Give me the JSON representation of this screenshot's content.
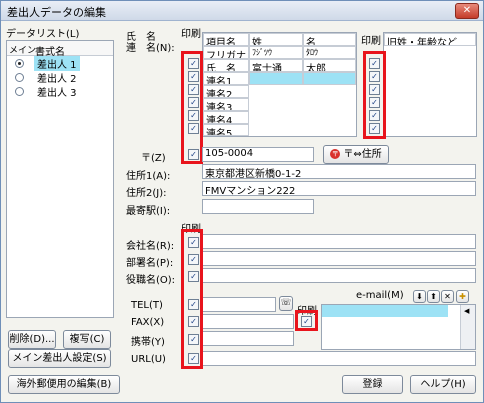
{
  "window": {
    "title": "差出人データの編集",
    "close_glyph": "✕"
  },
  "datalist": {
    "heading": "データリスト(L)",
    "col_main": "メイン",
    "col_name": "書式名",
    "items": [
      {
        "name": "差出人 1",
        "selected": true
      },
      {
        "name": "差出人 2",
        "selected": false
      },
      {
        "name": "差出人 3",
        "selected": false
      }
    ]
  },
  "buttons": {
    "delete": "削除(D)...",
    "copy": "複写(C)",
    "set_main": "メイン差出人設定(S)",
    "overseas": "海外郵便用の編集(B)",
    "register": "登録",
    "help": "ヘルプ(H)",
    "zip_to_address": "〒⇔住所"
  },
  "name_section": {
    "label_line1": "氏　名",
    "label_line2": "連　名(N):",
    "print_header": "印刷",
    "columns": [
      "項目名",
      "姓",
      "名"
    ],
    "rows": [
      {
        "item": "フリガナ",
        "sei": "ﾌｼﾞﾂｳ",
        "mei": "ﾀﾛｳ"
      },
      {
        "item": "氏　名",
        "sei": "富士通",
        "mei": "太郎"
      },
      {
        "item": "連名1",
        "sei": "",
        "mei": ""
      },
      {
        "item": "連名2",
        "sei": "",
        "mei": ""
      },
      {
        "item": "連名3",
        "sei": "",
        "mei": ""
      },
      {
        "item": "連名4",
        "sei": "",
        "mei": ""
      },
      {
        "item": "連名5",
        "sei": "",
        "mei": ""
      }
    ],
    "right_print_header": "印刷",
    "right_column": "旧姓・年齢など"
  },
  "address": {
    "zip_label": "〒(Z)",
    "zip_value": "105-0004",
    "addr1_label": "住所1(A):",
    "addr1_value": "東京都港区新橋0-1-2",
    "addr2_label": "住所2(J):",
    "addr2_value": "FMVマンション222",
    "station_label": "最寄駅(I):",
    "station_value": ""
  },
  "company": {
    "print_header": "印刷",
    "company_label": "会社名(R):",
    "dept_label": "部署名(P):",
    "title_label": "役職名(O):"
  },
  "contact": {
    "tel_label": "TEL(T)",
    "fax_label": "FAX(X)",
    "mobile_label": "携帯(Y)",
    "url_label": "URL(U)",
    "email_print_header": "印刷",
    "email_label": "e-mail(M)"
  },
  "colors": {
    "highlight_red": "#e8141c",
    "selection_blue": "#9de2f5"
  }
}
